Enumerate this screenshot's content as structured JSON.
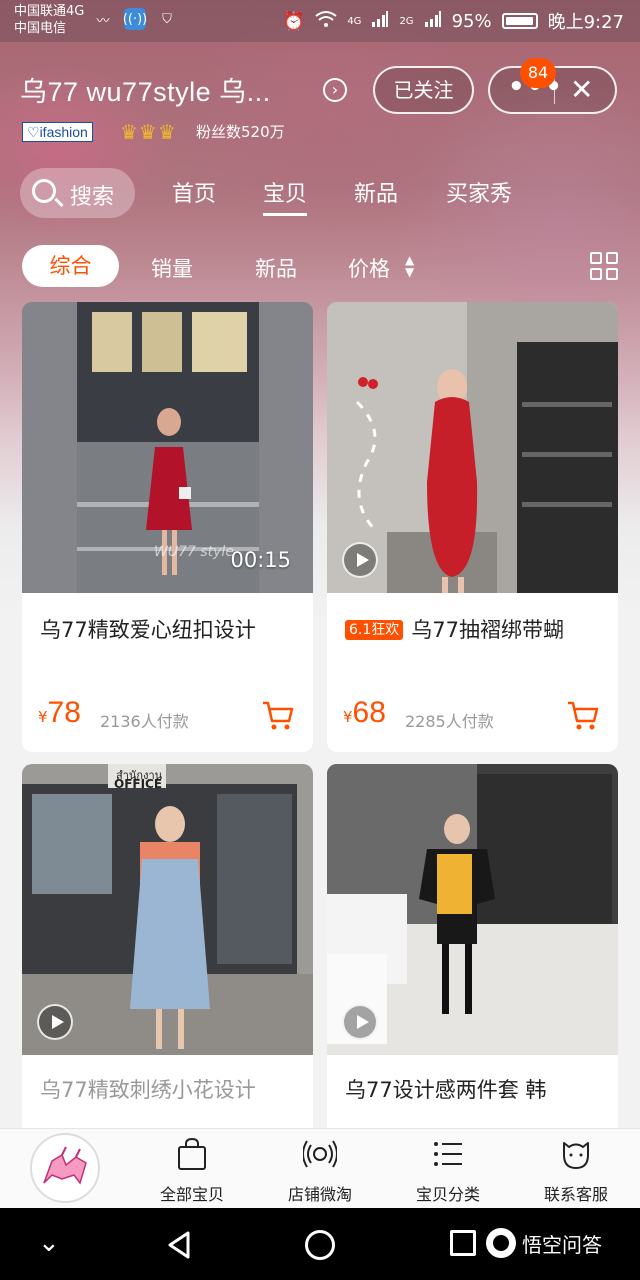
{
  "status_bar": {
    "carrier1": "中国联通4G",
    "carrier2": "中国电信",
    "signal_4g": "4G",
    "signal_2g": "2G",
    "battery": "95%",
    "time": "晚上9:27"
  },
  "store": {
    "title": "乌77 wu77style 乌...",
    "follow_label": "已关注",
    "notification_count": "84",
    "ifashion_label": "ifashion",
    "fans": "粉丝数520万"
  },
  "nav_tabs": {
    "search_label": "搜索",
    "items": [
      "首页",
      "宝贝",
      "新品",
      "买家秀"
    ],
    "active": "宝贝"
  },
  "sort_bar": {
    "items": [
      "综合",
      "销量",
      "新品",
      "价格"
    ],
    "active": "综合"
  },
  "products": [
    {
      "title": "乌77精致爱心纽扣设计",
      "price": "78",
      "currency": "¥",
      "sold": "2136人付款",
      "video_duration": "00:15",
      "watermark": "WU77 style"
    },
    {
      "title": "乌77抽褶绑带蝴",
      "promo": "6.1狂欢",
      "price": "68",
      "currency": "¥",
      "sold": "2285人付款"
    },
    {
      "title": "乌77精致刺绣小花设计"
    },
    {
      "title": "乌77设计感两件套 韩"
    }
  ],
  "sign_text": {
    "thai": "สำนักงาน",
    "office": "OFFICE"
  },
  "toolbar": {
    "items": [
      "全部宝贝",
      "店铺微淘",
      "宝贝分类",
      "联系客服"
    ]
  },
  "nav_bar": {
    "brand": "悟空问答"
  },
  "colors": {
    "accent": "#ff5000",
    "dark_text": "#222222",
    "muted_text": "#999999"
  }
}
